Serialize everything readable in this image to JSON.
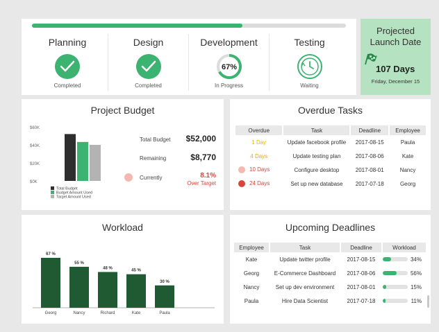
{
  "phases": {
    "progress": 0.67,
    "items": [
      {
        "name": "Planning",
        "status": "Completed",
        "state": "done"
      },
      {
        "name": "Design",
        "status": "Completed",
        "state": "done"
      },
      {
        "name": "Development",
        "status": "In Progress",
        "state": "progress",
        "percent_label": "67%",
        "percent": 67
      },
      {
        "name": "Testing",
        "status": "Waiting",
        "state": "waiting"
      }
    ]
  },
  "launch": {
    "title_line1": "Projected",
    "title_line2": "Launch Date",
    "days": "107 Days",
    "date": "Friday, December 15"
  },
  "budget": {
    "title": "Project Budget",
    "total_label": "Total Budget",
    "total_value": "$52,000",
    "remaining_label": "Remaining",
    "remaining_value": "$8,770",
    "current_label": "Currently",
    "current_value": "8.1%",
    "current_note": "Over Target"
  },
  "overdue": {
    "title": "Overdue Tasks",
    "headers": [
      "Overdue",
      "Task",
      "Deadline",
      "Employee"
    ],
    "rows": [
      {
        "overdue": "1 Day",
        "task": "Update facebook profile",
        "deadline": "2017-08-15",
        "employee": "Paula",
        "level": "low"
      },
      {
        "overdue": "4 Days",
        "task": "Update testing plan",
        "deadline": "2017-08-06",
        "employee": "Kate",
        "level": "low"
      },
      {
        "overdue": "10 Days",
        "task": "Configure desktop",
        "deadline": "2017-08-01",
        "employee": "Nancy",
        "level": "mid"
      },
      {
        "overdue": "24 Days",
        "task": "Set up new database",
        "deadline": "2017-07-18",
        "employee": "Georg",
        "level": "high"
      }
    ]
  },
  "workload": {
    "title": "Workload"
  },
  "upcoming": {
    "title": "Upcoming Deadlines",
    "headers": [
      "Employee",
      "Task",
      "Deadline",
      "Workload"
    ],
    "rows": [
      {
        "employee": "Kate",
        "task": "Update twitter profile",
        "deadline": "2017-08-15",
        "workload": "34%",
        "fraction": 0.34
      },
      {
        "employee": "Georg",
        "task": "E-Commerce Dashboard",
        "deadline": "2017-08-06",
        "workload": "56%",
        "fraction": 0.56
      },
      {
        "employee": "Nancy",
        "task": "Set up dev environment",
        "deadline": "2017-08-01",
        "workload": "15%",
        "fraction": 0.15
      },
      {
        "employee": "Paula",
        "task": "Hire Data Scientist",
        "deadline": "2017-07-18",
        "workload": "11%",
        "fraction": 0.11
      }
    ]
  },
  "colors": {
    "green": "#3cb371",
    "dark_green": "#1f5a33",
    "bar_dark": "#2e2e2e",
    "bar_gray": "#b3b3b3",
    "red": "#d9453a",
    "yellow": "#e6b800",
    "orange": "#f0a800",
    "launch_bg": "#b5e2c0"
  },
  "chart_data": [
    {
      "type": "bar",
      "categories": [
        "Total Budget",
        "Budget Amount Used",
        "Target Amount Used"
      ],
      "values": [
        52000,
        43230,
        40000
      ],
      "legend": [
        "Total Budget",
        "Budget Amount Used",
        "Target Amount Used"
      ],
      "yticks": [
        "$60K",
        "$40K",
        "$20K",
        "$0K"
      ],
      "ylim": [
        0,
        60000
      ],
      "legend_position": "bottom-left"
    },
    {
      "type": "bar",
      "categories": [
        "Georg",
        "Nancy",
        "Richard",
        "Kate",
        "Paula"
      ],
      "values": [
        67,
        55,
        48,
        45,
        30
      ],
      "labels": [
        "67 %",
        "55 %",
        "48 %",
        "45 %",
        "30 %"
      ],
      "ylim": [
        0,
        75
      ]
    }
  ]
}
